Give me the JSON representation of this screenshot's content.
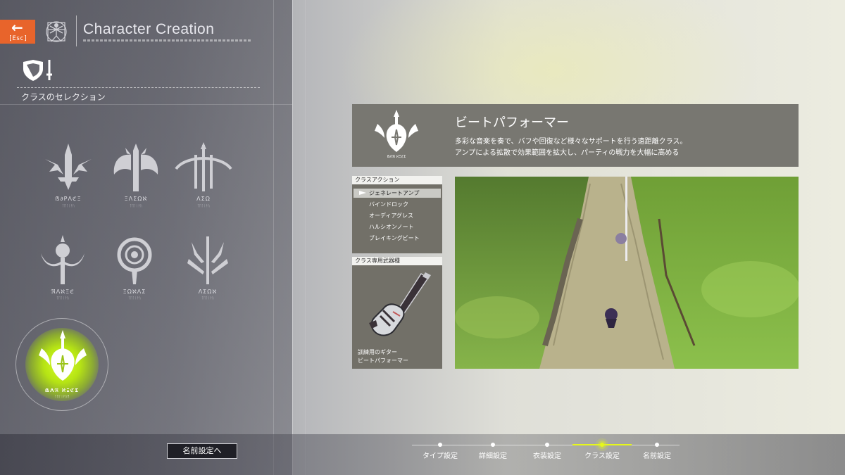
{
  "header": {
    "title": "Character Creation",
    "esc_label": "[Esc]"
  },
  "section": {
    "title": "クラスのセレクション"
  },
  "classes": [
    {
      "icon": "sword-emblem-icon"
    },
    {
      "icon": "axe-emblem-icon"
    },
    {
      "icon": "bow-emblem-icon"
    },
    {
      "icon": "staff-emblem-icon"
    },
    {
      "icon": "ring-emblem-icon"
    },
    {
      "icon": "trident-emblem-icon"
    },
    {
      "icon": "guitar-emblem-icon",
      "selected": true
    }
  ],
  "info": {
    "name": "ビートパフォーマー",
    "desc_line1": "多彩な音楽を奏で、バフや回復など様々なサポートを行う遠距離クラス。",
    "desc_line2": "アンプによる拡散で効果範囲を拡大し、パーティの戦力を大幅に高める"
  },
  "actions": {
    "header": "クラスアクション",
    "items": [
      "ジェネレートアンプ",
      "バインドロック",
      "オーディアグレス",
      "ハルシオンノート",
      "ブレイキングビート"
    ],
    "selected_index": 0
  },
  "weapon": {
    "header": "クラス専用武器種",
    "line1": "訓練用のギター",
    "line2": "ビートパフォーマー"
  },
  "footer": {
    "next_button": "名前設定へ",
    "steps": [
      "タイプ設定",
      "詳細設定",
      "衣装設定",
      "クラス設定",
      "名前設定"
    ],
    "active_step": 3
  },
  "colors": {
    "accent": "#e6f71b",
    "esc": "#e8642b",
    "selected_glow": "#c6f01a"
  }
}
